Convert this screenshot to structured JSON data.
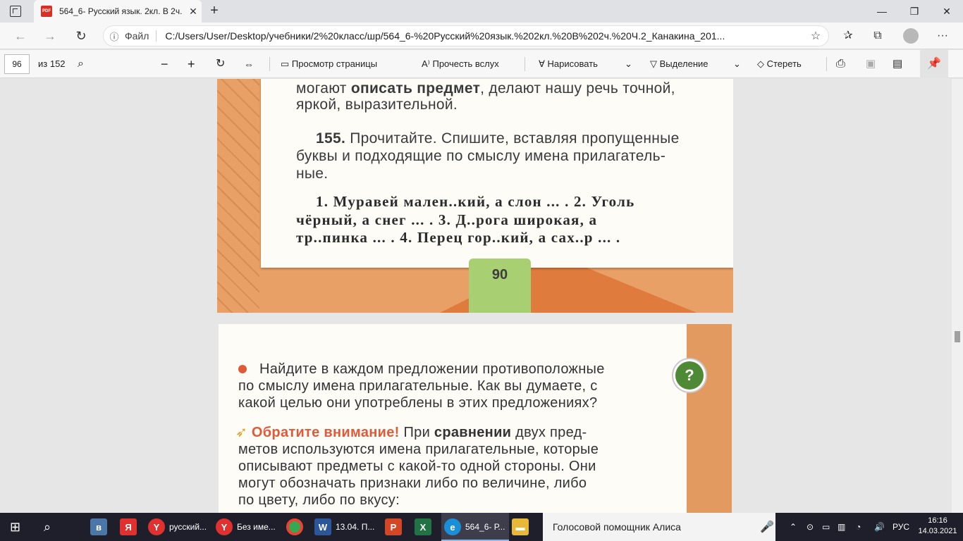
{
  "browser": {
    "tab_title": "564_6- Русский язык. 2кл. В 2ч.",
    "tab_close": "✕",
    "new_tab": "+",
    "window": {
      "minimize": "—",
      "maximize": "❐",
      "close": "✕"
    },
    "address": {
      "scheme": "Файл",
      "url": "C:/Users/User/Desktop/учебники/2%20класс/шр/564_6-%20Русский%20язык.%202кл.%20В%202ч.%20Ч.2_Канакина_201..."
    }
  },
  "pdf_toolbar": {
    "page_number": "96",
    "page_total": "из 152",
    "view_page": "Просмотр страницы",
    "read_aloud": "Прочесть вслух",
    "draw": "Нарисовать",
    "highlight": "Выделение",
    "erase": "Стереть"
  },
  "page1": {
    "line1_pre": "могают ",
    "line1_bold": "описать предмет",
    "line1_post": ", делают нашу речь точной,",
    "line2": "яркой, выразительной.",
    "ex_num": "155.",
    "ex_line1": " Прочитайте. Спишите, вставляя пропущенные",
    "ex_line2": "буквы и подходящие по смыслу имена прилагатель-",
    "ex_line3": "ные.",
    "task_line1": "1. Муравей мален..кий, а слон ... . 2. Уголь",
    "task_line2": "чёрный, а снег ... . 3. Д..рога широкая, а",
    "task_line3": "тр..пинка ... . 4. Перец гор..кий, а сах..р ... .",
    "page_num": "90"
  },
  "page2": {
    "q_line1": "Найдите в каждом предложении противоположные",
    "q_line2": "по смыслу имена прилагательные. Как вы думаете, с",
    "q_line3": "какой целью они употреблены в этих предложениях?",
    "q_icon": "?",
    "note_title": "Обратите внимание!",
    "note_l1_a": " При ",
    "note_l1_bold": "сравнении",
    "note_l1_b": " двух пред-",
    "note_line2": "метов используются имена прилагательные, которые",
    "note_line3": "описывают предметы с какой-то одной стороны. Они",
    "note_line4": "могут обозначать признаки либо по величине, либо",
    "note_line5": "по цвету, либо по вкусу:"
  },
  "taskbar": {
    "app_yandex1": "русский...",
    "app_yandex2": "Без име...",
    "app_word": "13.04. П...",
    "app_edge": "564_6- Р...",
    "alisa": "Голосовой помощник Алиса",
    "lang": "РУС",
    "time": "16:16",
    "date": "14.03.2021"
  }
}
